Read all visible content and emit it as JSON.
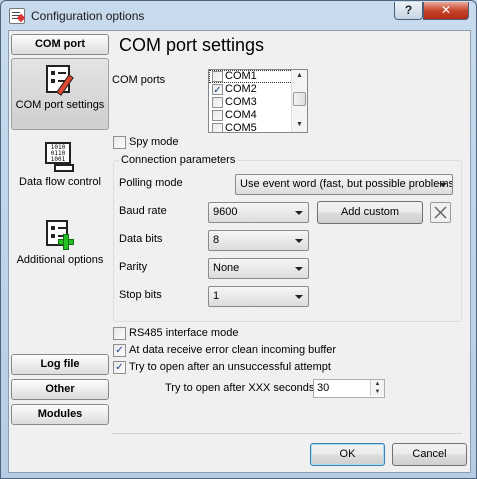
{
  "window": {
    "title": "Configuration options",
    "help_label": "?",
    "close_label": "✕"
  },
  "nav": {
    "com_port_header": "COM port",
    "items": [
      {
        "label": "COM port settings",
        "icon": "settings-document-icon",
        "selected": true
      },
      {
        "label": "Data flow control",
        "icon": "binary-data-icon",
        "selected": false
      },
      {
        "label": "Additional options",
        "icon": "add-document-icon",
        "selected": false
      }
    ],
    "bottom_headers": [
      "Log file",
      "Other",
      "Modules"
    ]
  },
  "page": {
    "title": "COM port settings",
    "com_ports_label": "COM ports",
    "com_ports": [
      {
        "name": "COM1",
        "checked": false
      },
      {
        "name": "COM2",
        "checked": true
      },
      {
        "name": "COM3",
        "checked": false
      },
      {
        "name": "COM4",
        "checked": false
      },
      {
        "name": "COM5",
        "checked": false
      }
    ],
    "spy_mode": {
      "label": "Spy mode",
      "checked": false
    },
    "connection": {
      "group_title": "Connection parameters",
      "polling_mode": {
        "label": "Polling mode",
        "value": "Use event word (fast, but possible problems)"
      },
      "baud_rate": {
        "label": "Baud rate",
        "value": "9600"
      },
      "add_custom_label": "Add custom",
      "data_bits": {
        "label": "Data bits",
        "value": "8"
      },
      "parity": {
        "label": "Parity",
        "value": "None"
      },
      "stop_bits": {
        "label": "Stop bits",
        "value": "1"
      }
    },
    "rs485": {
      "label": "RS485 interface mode",
      "checked": false
    },
    "clean_buffer": {
      "label": "At data receive error clean incoming buffer",
      "checked": true
    },
    "retry_open": {
      "label": "Try to open after an unsuccessful attempt",
      "checked": true
    },
    "retry_seconds": {
      "label": "Try to open after XXX seconds",
      "value": "30"
    }
  },
  "footer": {
    "ok_label": "OK",
    "cancel_label": "Cancel"
  }
}
